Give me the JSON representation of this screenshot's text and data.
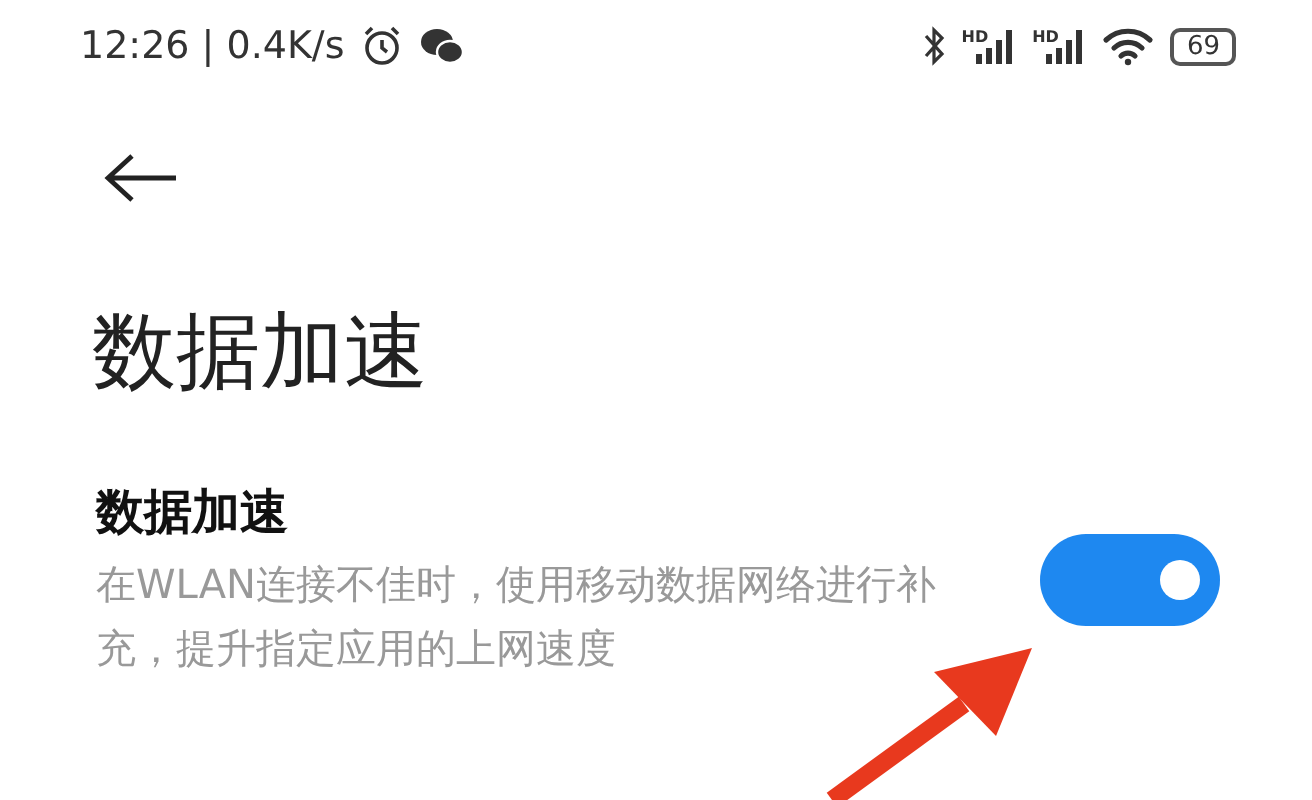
{
  "status_bar": {
    "time": "12:26 | 0.4K/s",
    "signals": [
      {
        "label": "HD"
      },
      {
        "label": "HD"
      }
    ],
    "battery": "69"
  },
  "page": {
    "title": "数据加速"
  },
  "setting": {
    "title": "数据加速",
    "description": "在WLAN连接不佳时，使用移动数据网络进行补充，提升指定应用的上网速度",
    "on": true
  }
}
